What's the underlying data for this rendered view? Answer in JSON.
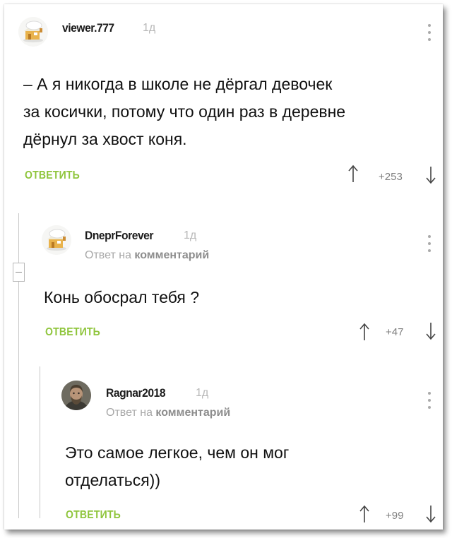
{
  "comments": [
    {
      "username": "viewer.777",
      "age": "1д",
      "text_lines": [
        "– А я никогда в школе не дёргал девочек",
        "за косички, потому что один раз в деревне",
        "дёрнул за хвост коня."
      ],
      "reply_label": "ОТВЕТИТЬ",
      "rating": "+253",
      "avatar_icon": "default-house-avatar-icon"
    },
    {
      "username": "DneprForever",
      "age": "1д",
      "reply_to_prefix": "Ответ на",
      "reply_to_link": "комментарий",
      "text_lines": [
        "Конь обосрал тебя ?"
      ],
      "reply_label": "ОТВЕТИТЬ",
      "rating": "+47",
      "avatar_icon": "default-house-avatar-icon"
    },
    {
      "username": "Ragnar2018",
      "age": "1д",
      "reply_to_prefix": "Ответ на",
      "reply_to_link": "комментарий",
      "text_lines": [
        "Это самое легкое, чем он мог",
        "отделаться))"
      ],
      "reply_label": "ОТВЕТИТЬ",
      "rating": "+99",
      "avatar_icon": "bearded-man-photo-avatar-icon"
    }
  ],
  "colors": {
    "reply_green": "#8fc53c",
    "text": "#111111",
    "muted": "#b8b8b8",
    "thread_line": "#c8c8c8"
  }
}
